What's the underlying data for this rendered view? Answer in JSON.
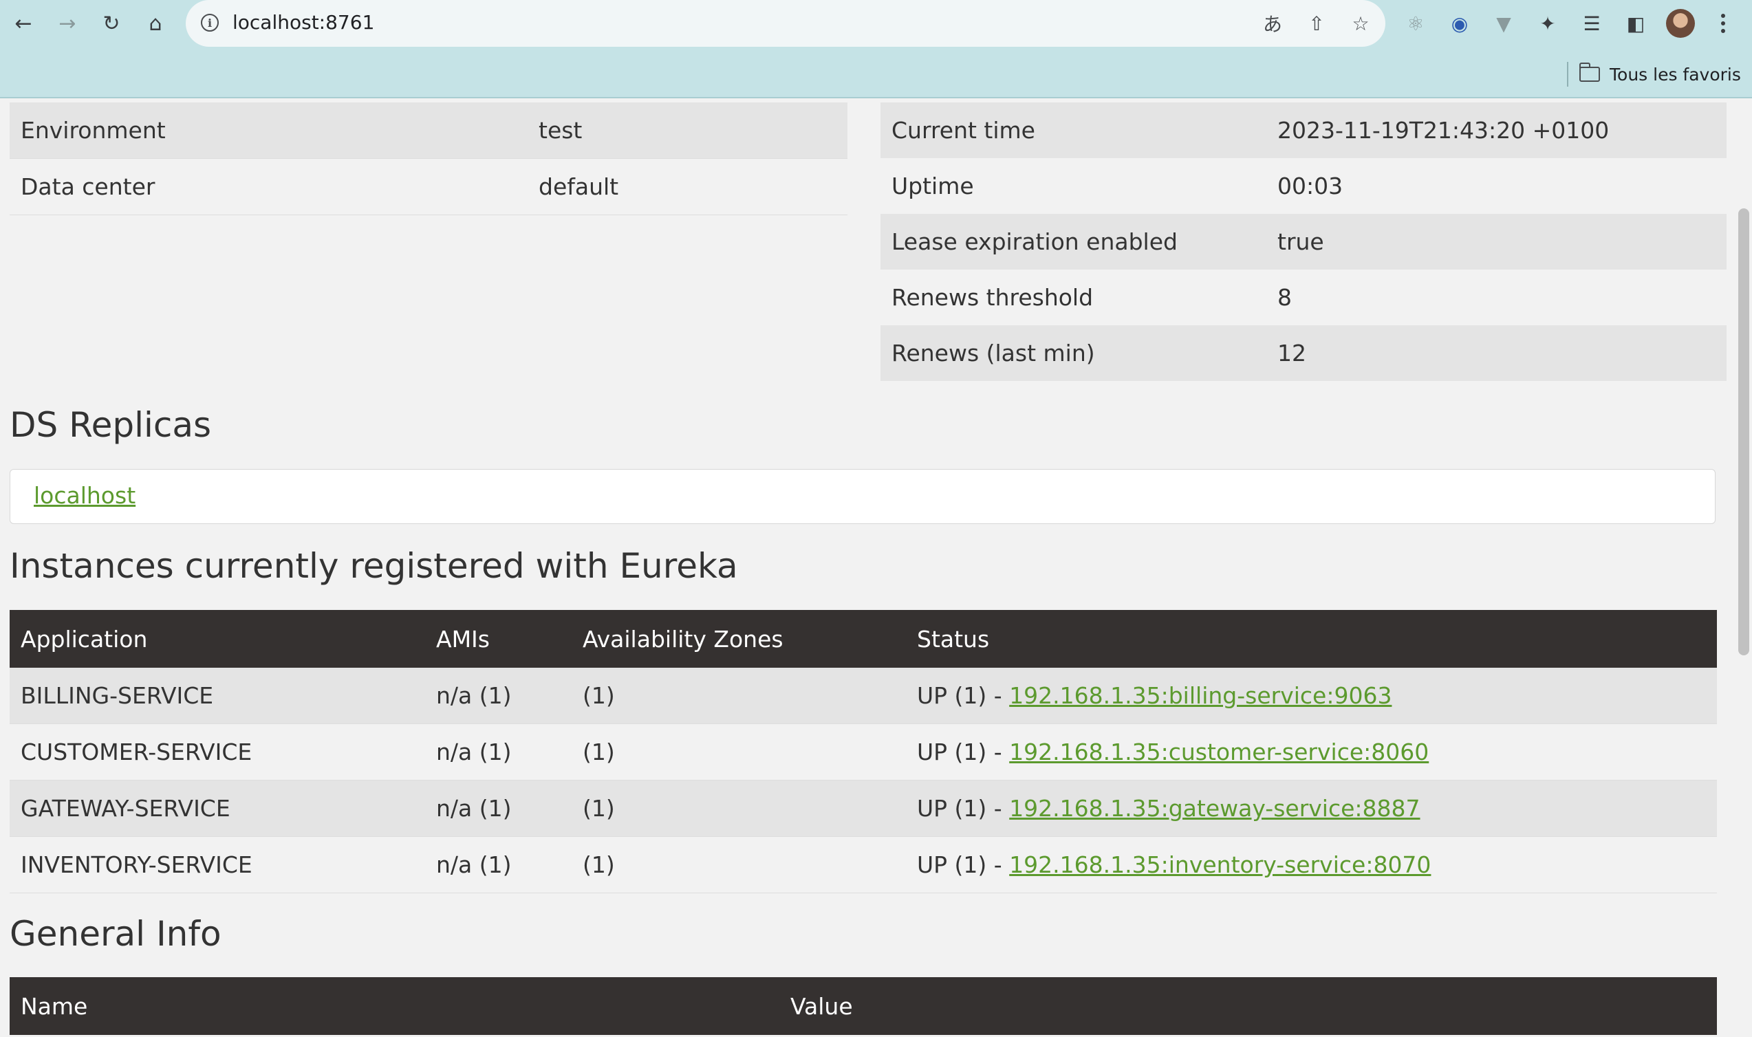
{
  "browser": {
    "url": "localhost:8761",
    "bookmarks_folder": "Tous les favoris"
  },
  "left_info": [
    {
      "label": "Environment",
      "value": "test"
    },
    {
      "label": "Data center",
      "value": "default"
    }
  ],
  "right_info": [
    {
      "label": "Current time",
      "value": "2023-11-19T21:43:20 +0100"
    },
    {
      "label": "Uptime",
      "value": "00:03"
    },
    {
      "label": "Lease expiration enabled",
      "value": "true"
    },
    {
      "label": "Renews threshold",
      "value": "8"
    },
    {
      "label": "Renews (last min)",
      "value": "12"
    }
  ],
  "ds_replicas": {
    "heading": "DS Replicas",
    "replica": "localhost"
  },
  "instances": {
    "heading": "Instances currently registered with Eureka",
    "columns": [
      "Application",
      "AMIs",
      "Availability Zones",
      "Status"
    ],
    "rows": [
      {
        "app": "BILLING-SERVICE",
        "amis": "n/a (1)",
        "zones": "(1)",
        "status_prefix": "UP (1) - ",
        "link": "192.168.1.35:billing-service:9063"
      },
      {
        "app": "CUSTOMER-SERVICE",
        "amis": "n/a (1)",
        "zones": "(1)",
        "status_prefix": "UP (1) - ",
        "link": "192.168.1.35:customer-service:8060"
      },
      {
        "app": "GATEWAY-SERVICE",
        "amis": "n/a (1)",
        "zones": "(1)",
        "status_prefix": "UP (1) - ",
        "link": "192.168.1.35:gateway-service:8887"
      },
      {
        "app": "INVENTORY-SERVICE",
        "amis": "n/a (1)",
        "zones": "(1)",
        "status_prefix": "UP (1) - ",
        "link": "192.168.1.35:inventory-service:8070"
      }
    ]
  },
  "general_info": {
    "heading": "General Info",
    "columns": [
      "Name",
      "Value"
    ]
  },
  "colors": {
    "link": "#5c9a2e",
    "table_header_bg": "#353130",
    "chrome_bg": "#c5e3e6"
  }
}
